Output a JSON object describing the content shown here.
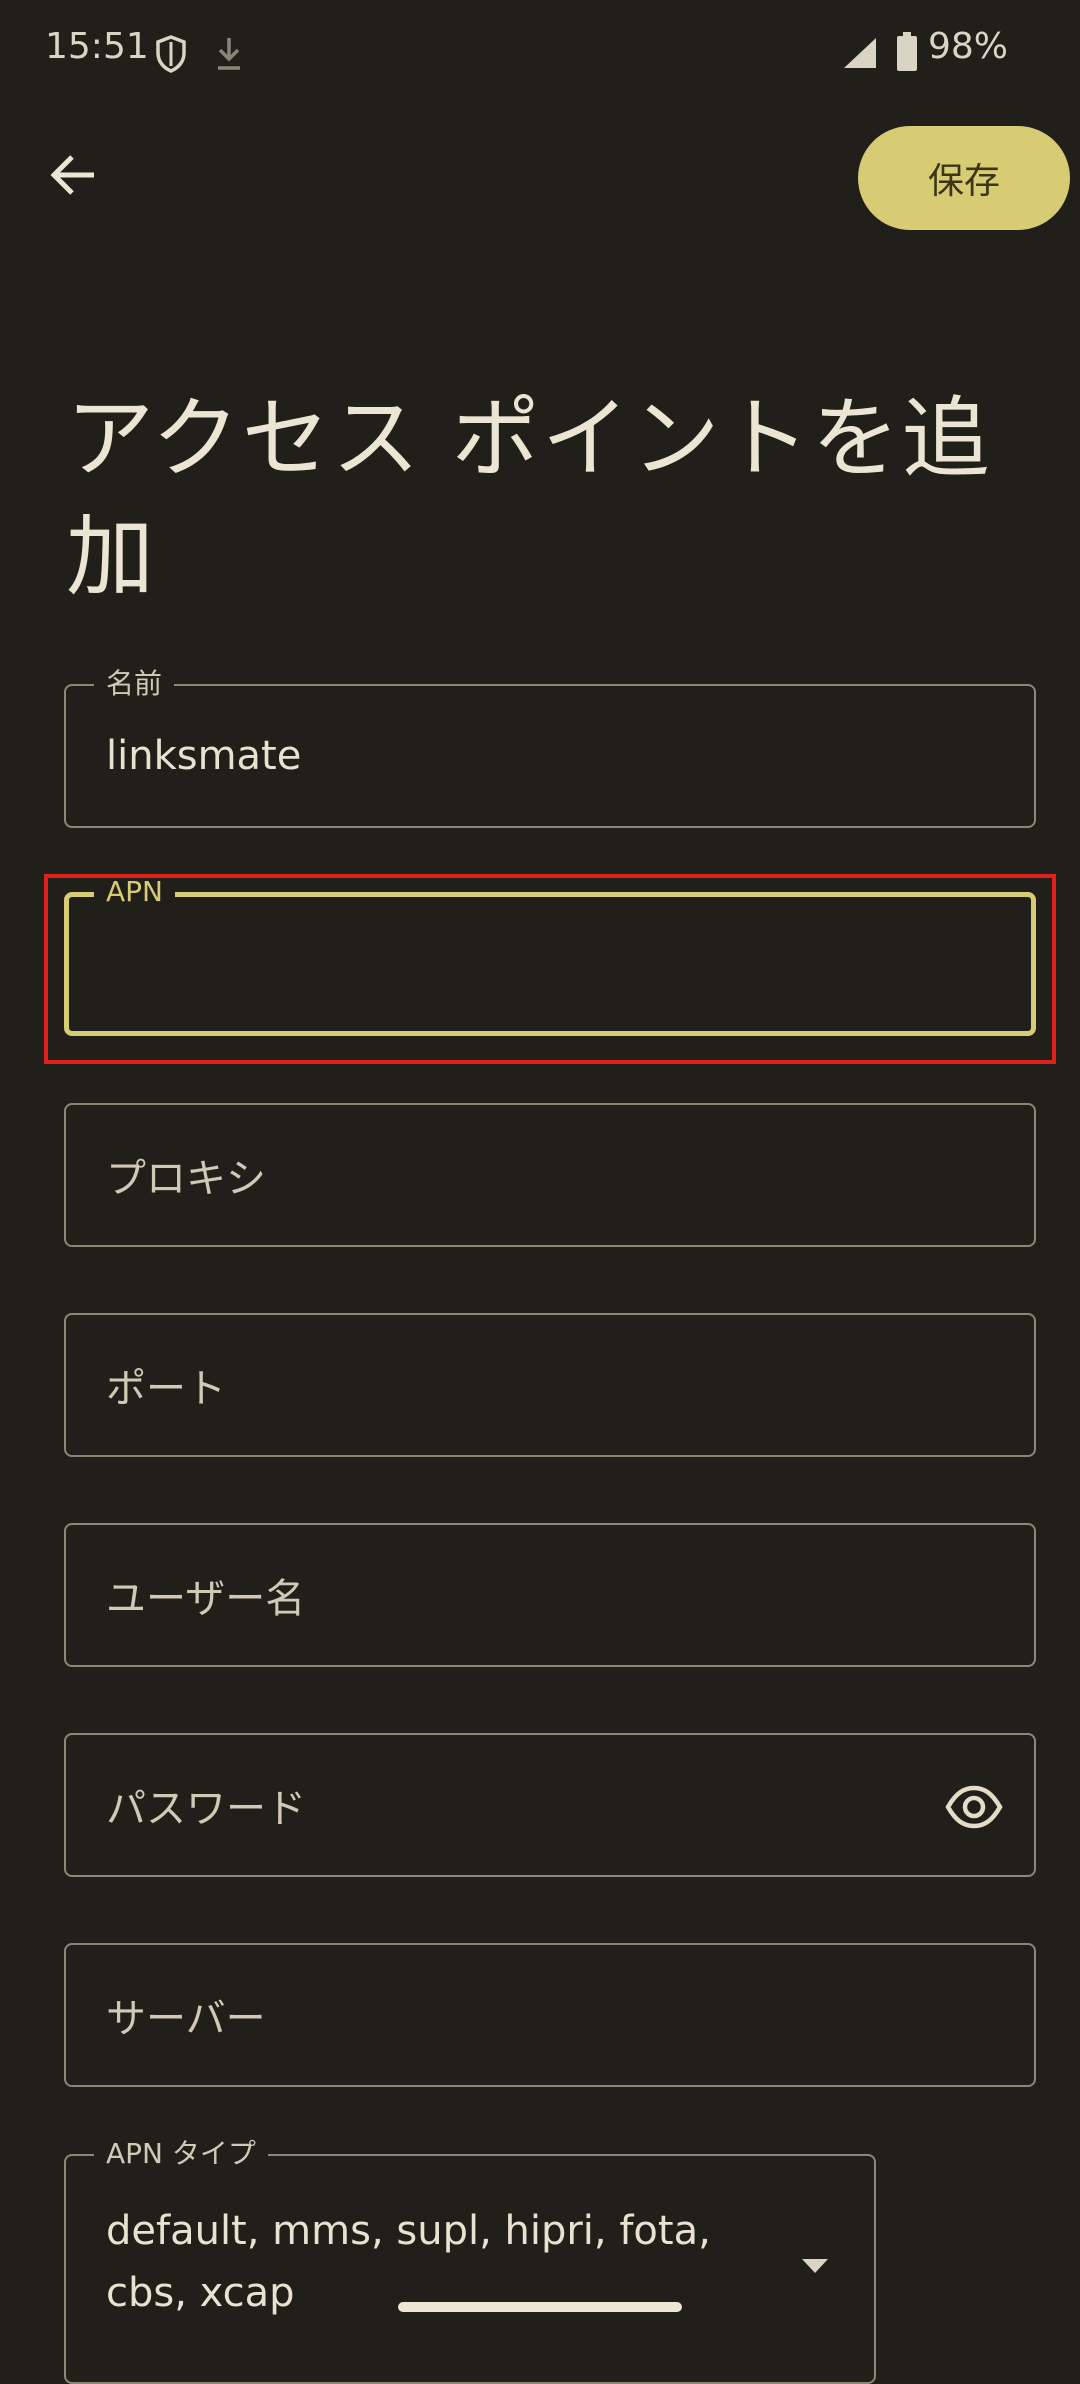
{
  "status_bar": {
    "time": "15:51",
    "battery": "98%",
    "icons": [
      "shield-icon",
      "download-icon",
      "signal-icon",
      "battery-icon"
    ]
  },
  "toolbar": {
    "back_icon": "arrow-left-icon",
    "save_label": "保存"
  },
  "title": "アクセス ポイントを追加",
  "fields": {
    "name": {
      "label": "名前",
      "value": "linksmate"
    },
    "apn": {
      "label": "APN",
      "value": ""
    },
    "proxy": {
      "placeholder": "プロキシ"
    },
    "port": {
      "placeholder": "ポート"
    },
    "username": {
      "placeholder": "ユーザー名"
    },
    "password": {
      "placeholder": "パスワード",
      "toggle_icon": "eye-icon"
    },
    "server": {
      "placeholder": "サーバー"
    },
    "apn_type": {
      "label": "APN タイプ",
      "value": "default, mms, supl, hipri, fota, cbs, xcap"
    }
  },
  "colors": {
    "background": "#201f19",
    "accent": "#d7cc74",
    "highlight": "#e0201b"
  }
}
